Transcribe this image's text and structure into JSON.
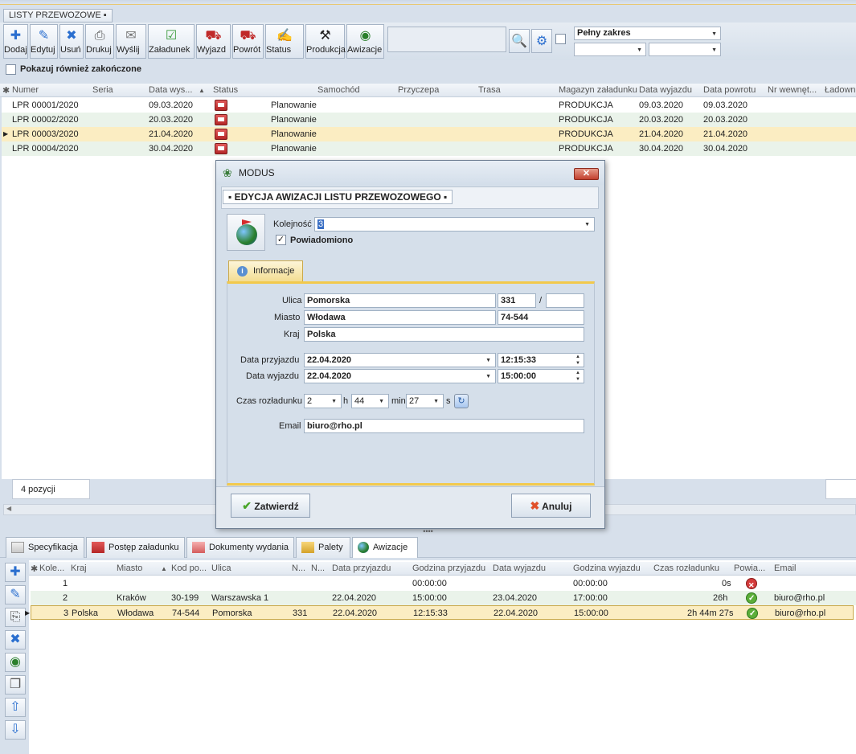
{
  "window": {
    "title": "LISTY PRZEWOZOWE"
  },
  "toolbar": {
    "buttons": [
      {
        "label": "Dodaj",
        "icon": "plus-icon"
      },
      {
        "label": "Edytuj",
        "icon": "pencil-icon"
      },
      {
        "label": "Usuń",
        "icon": "delete-icon"
      },
      {
        "label": "Drukuj",
        "icon": "printer-icon"
      },
      {
        "label": "Wyślij",
        "icon": "envelope-icon"
      },
      {
        "label": "Załadunek",
        "icon": "checklist-icon"
      },
      {
        "label": "Wyjazd",
        "icon": "truck-out-icon"
      },
      {
        "label": "Powrót",
        "icon": "truck-return-icon"
      },
      {
        "label": "Status",
        "icon": "status-icon"
      },
      {
        "label": "Produkcja",
        "icon": "production-icon"
      },
      {
        "label": "Awizacje",
        "icon": "globe-icon"
      }
    ],
    "search_value": "",
    "range_select": "Pełny zakres",
    "show_finished_label": "Pokazuj również zakończone"
  },
  "main_grid": {
    "columns": [
      "Numer",
      "Seria",
      "Data wys...",
      "Status",
      "Samochód",
      "Przyczepa",
      "Trasa",
      "Magazyn załadunku",
      "Data wyjazdu",
      "Data powrotu",
      "Nr wewnęt...",
      "Ładowność"
    ],
    "rows": [
      {
        "numer": "LPR 00001/2020",
        "data": "09.03.2020",
        "status": "Planowanie",
        "magazyn": "PRODUKCJA",
        "wyjazd": "09.03.2020",
        "powrot": "09.03.2020"
      },
      {
        "numer": "LPR 00002/2020",
        "data": "20.03.2020",
        "status": "Planowanie",
        "magazyn": "PRODUKCJA",
        "wyjazd": "20.03.2020",
        "powrot": "20.03.2020"
      },
      {
        "numer": "LPR 00003/2020",
        "data": "21.04.2020",
        "status": "Planowanie",
        "magazyn": "PRODUKCJA",
        "wyjazd": "21.04.2020",
        "powrot": "21.04.2020"
      },
      {
        "numer": "LPR 00004/2020",
        "data": "30.04.2020",
        "status": "Planowanie",
        "magazyn": "PRODUKCJA",
        "wyjazd": "30.04.2020",
        "powrot": "30.04.2020"
      }
    ],
    "count_label": "4 pozycji"
  },
  "bottom_tabs": [
    "Specyfikacja",
    "Postęp załadunku",
    "Dokumenty wydania",
    "Palety",
    "Awizacje"
  ],
  "awizacje_grid": {
    "columns": [
      "Kole...",
      "Kraj",
      "Miasto",
      "Kod po...",
      "Ulica",
      "N...",
      "N...",
      "Data przyjazdu",
      "Godzina przyjazdu",
      "Data wyjazdu",
      "Godzina wyjazdu",
      "Czas rozładunku",
      "Powia...",
      "Email"
    ],
    "rows": [
      {
        "kol": "1",
        "kraj": "",
        "miasto": "",
        "kod": "",
        "ulica": "",
        "nr": "",
        "dprzy": "",
        "gprzy": "00:00:00",
        "dwyj": "",
        "gwyj": "00:00:00",
        "czas": "0s",
        "powiad": "no",
        "email": ""
      },
      {
        "kol": "2",
        "kraj": "",
        "miasto": "Kraków",
        "kod": "30-199",
        "ulica": "Warszawska 1",
        "nr": "",
        "dprzy": "22.04.2020",
        "gprzy": "15:00:00",
        "dwyj": "23.04.2020",
        "gwyj": "17:00:00",
        "czas": "26h",
        "powiad": "yes",
        "email": "biuro@rho.pl"
      },
      {
        "kol": "3",
        "kraj": "Polska",
        "miasto": "Włodawa",
        "kod": "74-544",
        "ulica": "Pomorska",
        "nr": "331",
        "dprzy": "22.04.2020",
        "gprzy": "12:15:33",
        "dwyj": "22.04.2020",
        "gwyj": "15:00:00",
        "czas": "2h 44m 27s",
        "powiad": "yes",
        "email": "biuro@rho.pl"
      }
    ]
  },
  "modal": {
    "title": "MODUS",
    "header": "EDYCJA AWIZACJI LISTU PRZEWOZOWEGO",
    "kolejnosc_label": "Kolejność",
    "kolejnosc_value": "3",
    "powiadomiono_label": "Powiadomiono",
    "tab_label": "Informacje",
    "ulica_label": "Ulica",
    "ulica": "Pomorska",
    "nr_domu": "331",
    "slash": "/",
    "nr_lokalu": "",
    "miasto_label": "Miasto",
    "miasto": "Włodawa",
    "kod": "74-544",
    "kraj_label": "Kraj",
    "kraj": "Polska",
    "data_przyjazdu_label": "Data przyjazdu",
    "data_przyjazdu": "22.04.2020",
    "godzina_przyjazdu": "12:15:33",
    "data_wyjazdu_label": "Data wyjazdu",
    "data_wyjazdu": "22.04.2020",
    "godzina_wyjazdu": "15:00:00",
    "czas_label": "Czas rozładunku",
    "czas_h": "2",
    "h_label": "h",
    "czas_min": "44",
    "min_label": "min",
    "czas_s": "27",
    "s_label": "s",
    "email_label": "Email",
    "email": "biuro@rho.pl",
    "confirm": "Zatwierdź",
    "cancel": "Anuluj"
  }
}
